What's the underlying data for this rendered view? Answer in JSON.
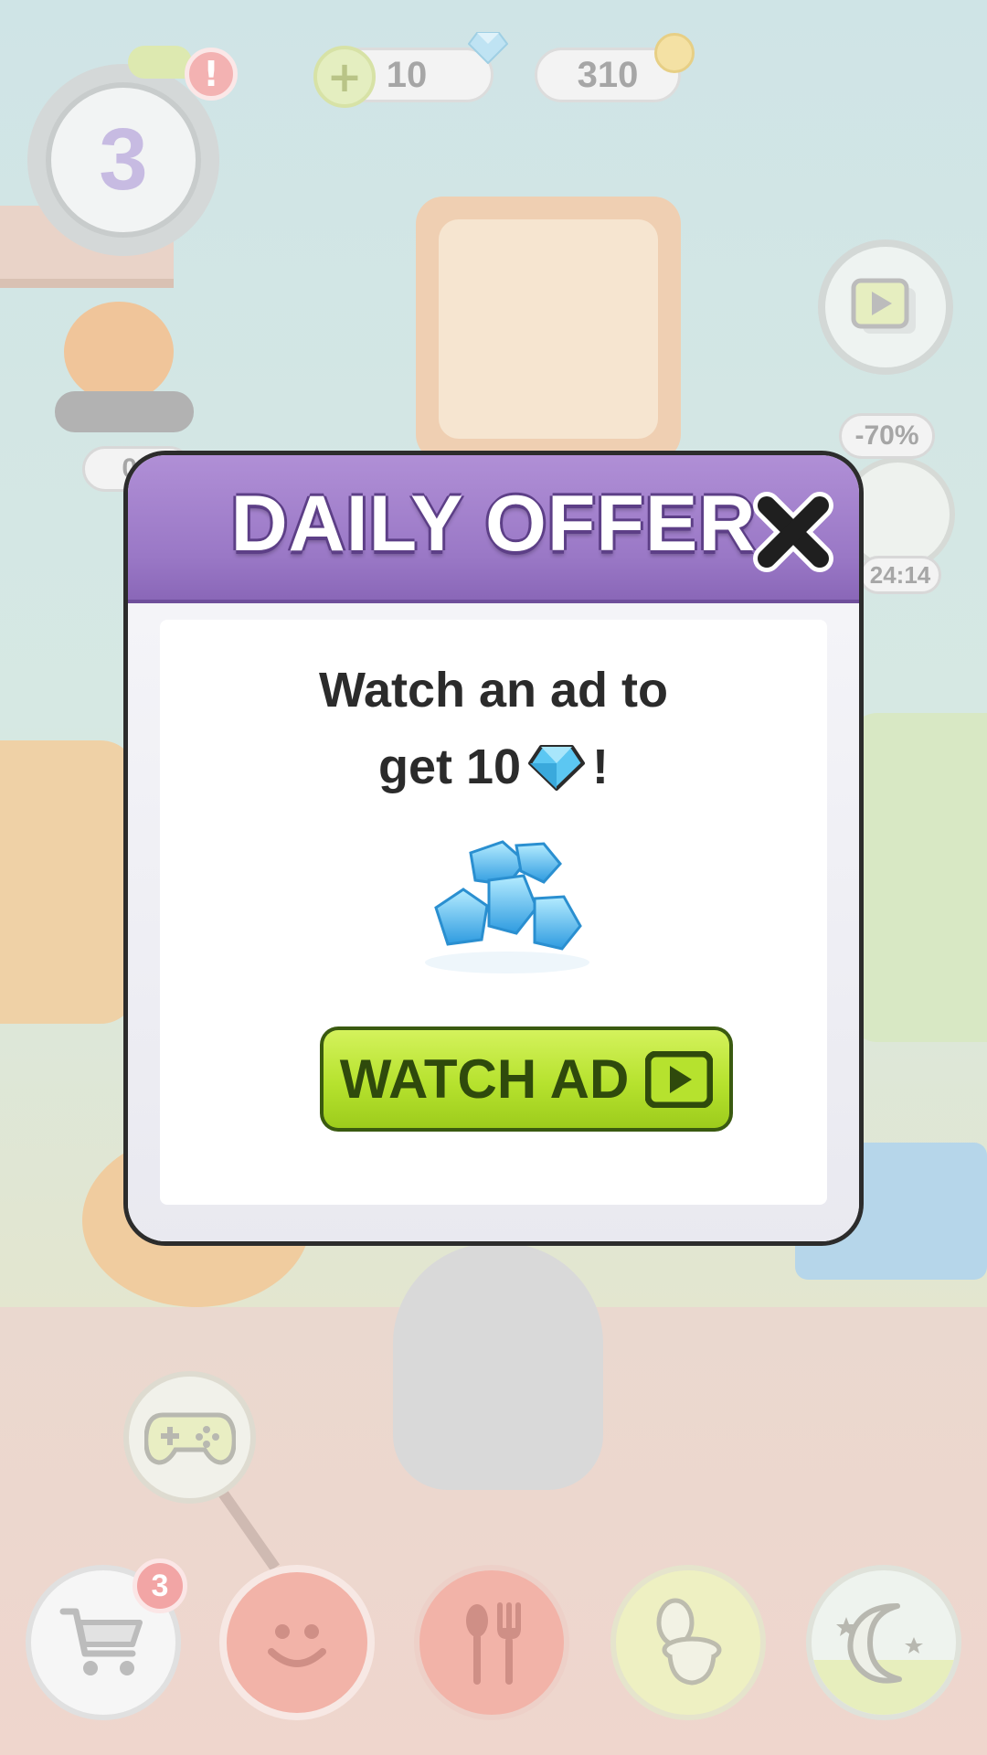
{
  "hud": {
    "level": "3",
    "alert_badge": "!",
    "gems": "10",
    "coins": "310",
    "progress_label": "0 /",
    "discount": "-70%",
    "timer": "24:14"
  },
  "bottom_nav": {
    "shop_badge": "3"
  },
  "modal": {
    "title": "DAILY OFFER",
    "message_line1": "Watch an ad to",
    "message_line2_prefix": "get 10",
    "message_line2_suffix": "!",
    "button_label": "WATCH AD"
  },
  "colors": {
    "header_purple": "#9a78c6",
    "button_green": "#b6e22e",
    "gem_blue": "#4fc3f0"
  }
}
